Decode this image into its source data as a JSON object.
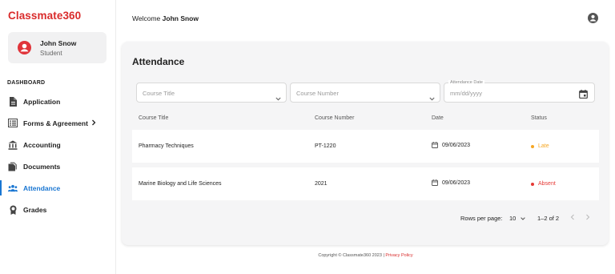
{
  "app": {
    "brand": "Classmate360",
    "brand_color": "#d92b2b",
    "accent_color": "#1976d2"
  },
  "user": {
    "name": "John Snow",
    "role": "Student",
    "avatar_icon": "account-circle-icon"
  },
  "header": {
    "welcome_prefix": "Welcome",
    "welcome_name": "John Snow",
    "account_icon": "account-circle-icon"
  },
  "sidebar": {
    "section": "DASHBOARD",
    "items": [
      {
        "label": "Application",
        "icon": "document-icon",
        "active": false
      },
      {
        "label": "Forms & Agreement",
        "icon": "forms-icon",
        "active": false,
        "has_submenu": true
      },
      {
        "label": "Accounting",
        "icon": "bank-icon",
        "active": false
      },
      {
        "label": "Documents",
        "icon": "documents-icon",
        "active": false
      },
      {
        "label": "Attendance",
        "icon": "people-icon",
        "active": true
      },
      {
        "label": "Grades",
        "icon": "award-icon",
        "active": false
      }
    ]
  },
  "main": {
    "title": "Attendance",
    "filters": {
      "course_title_placeholder": "Course Title",
      "course_number_placeholder": "Course Number",
      "date_label": "Attendance Date",
      "date_placeholder": "mm/dd/yyyy"
    },
    "table": {
      "columns": [
        "Course Title",
        "Course Number",
        "Date",
        "Status"
      ],
      "rows": [
        {
          "course_title": "Pharmacy Techniques",
          "course_number": "PT-1220",
          "date": "09/06/2023",
          "status": "Late",
          "status_color": "#f5a623"
        },
        {
          "course_title": "Marine Biology and Life Sciences",
          "course_number": "2021",
          "date": "09/06/2023",
          "status": "Absent",
          "status_color": "#e53935"
        }
      ]
    },
    "pagination": {
      "rows_per_page_label": "Rows per page:",
      "rows_per_page": "10",
      "range": "1–2 of 2"
    }
  },
  "footer": {
    "copyright": "Copyright © Classmate360 2023 | ",
    "privacy_link": "Privacy Policy"
  }
}
